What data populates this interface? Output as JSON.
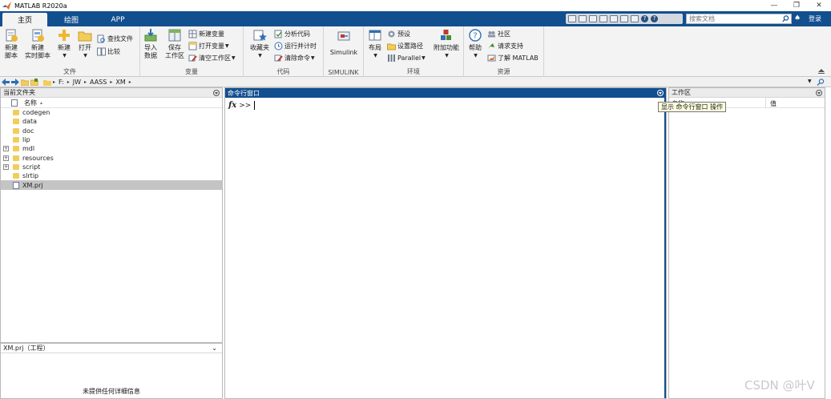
{
  "window": {
    "title": "MATLAB R2020a",
    "minimize": "—",
    "restore": "❐",
    "close": "✕"
  },
  "tabs": [
    {
      "label": "主页",
      "active": true
    },
    {
      "label": "绘图",
      "active": false
    },
    {
      "label": "APP",
      "active": false
    }
  ],
  "quick_access": {
    "help": "?",
    "help2": "?"
  },
  "search": {
    "placeholder": "搜索文档"
  },
  "account": {
    "bell": "♠",
    "login": "登录"
  },
  "ribbon": {
    "file": {
      "title": "文件",
      "new_script": [
        "新建",
        "脚本"
      ],
      "new_live_script": [
        "新建",
        "实时脚本"
      ],
      "new": "新建",
      "open": "打开",
      "find_files": "查找文件",
      "compare": "比较"
    },
    "variable": {
      "title": "变量",
      "import_data": [
        "导入",
        "数据"
      ],
      "save_workspace": [
        "保存",
        "工作区"
      ],
      "new_variable": "新建变量",
      "open_variable": "打开变量",
      "clear_workspace": "清空工作区"
    },
    "code": {
      "title": "代码",
      "favorites": "收藏夹",
      "analyze_code": "分析代码",
      "run_and_time": "运行并计时",
      "clear_commands": "清除命令"
    },
    "simulink": {
      "title": "SIMULINK",
      "simulink": "Simulink"
    },
    "environment": {
      "title": "环境",
      "layout": "布局",
      "preferences": "预设",
      "set_path": "设置路径",
      "parallel": "Parallel",
      "add_ons": "附加功能"
    },
    "resources": {
      "title": "资源",
      "help": "帮助",
      "community": "社区",
      "request_support": "请求支持",
      "learn_matlab": "了解 MATLAB"
    }
  },
  "path": {
    "root": "▸",
    "segments": [
      "F:",
      "JW",
      "AASS",
      "XM"
    ],
    "arrow": "▸"
  },
  "current_folder": {
    "title": "当前文件夹",
    "name_col": "名称",
    "sort_arrow": "▴",
    "items": [
      {
        "name": "codegen",
        "type": "folder",
        "expandable": false
      },
      {
        "name": "data",
        "type": "folder",
        "expandable": false
      },
      {
        "name": "doc",
        "type": "folder",
        "expandable": false
      },
      {
        "name": "lip",
        "type": "folder",
        "expandable": false
      },
      {
        "name": "mdl",
        "type": "folder",
        "expandable": true
      },
      {
        "name": "resources",
        "type": "folder",
        "expandable": true
      },
      {
        "name": "script",
        "type": "folder",
        "expandable": true
      },
      {
        "name": "slrtip",
        "type": "folder",
        "expandable": false
      },
      {
        "name": "XM.prj",
        "type": "project",
        "expandable": false,
        "selected": true
      }
    ]
  },
  "details": {
    "title": "XM.prj（工程）",
    "empty_text": "未提供任何详细信息"
  },
  "command_window": {
    "title": "命令行窗口",
    "fx": "fx",
    "prompt": ">>"
  },
  "tooltip": {
    "text": "显示 命令行窗口 操作"
  },
  "workspace": {
    "title": "工作区",
    "name_col": "名称",
    "value_col": "值"
  },
  "watermark": "CSDN @叶V",
  "colors": {
    "tab_bar": "#124f8f",
    "ribbon": "#f3f3f3",
    "selection": "#c4c4c4",
    "tooltip": "#ffffe1"
  }
}
